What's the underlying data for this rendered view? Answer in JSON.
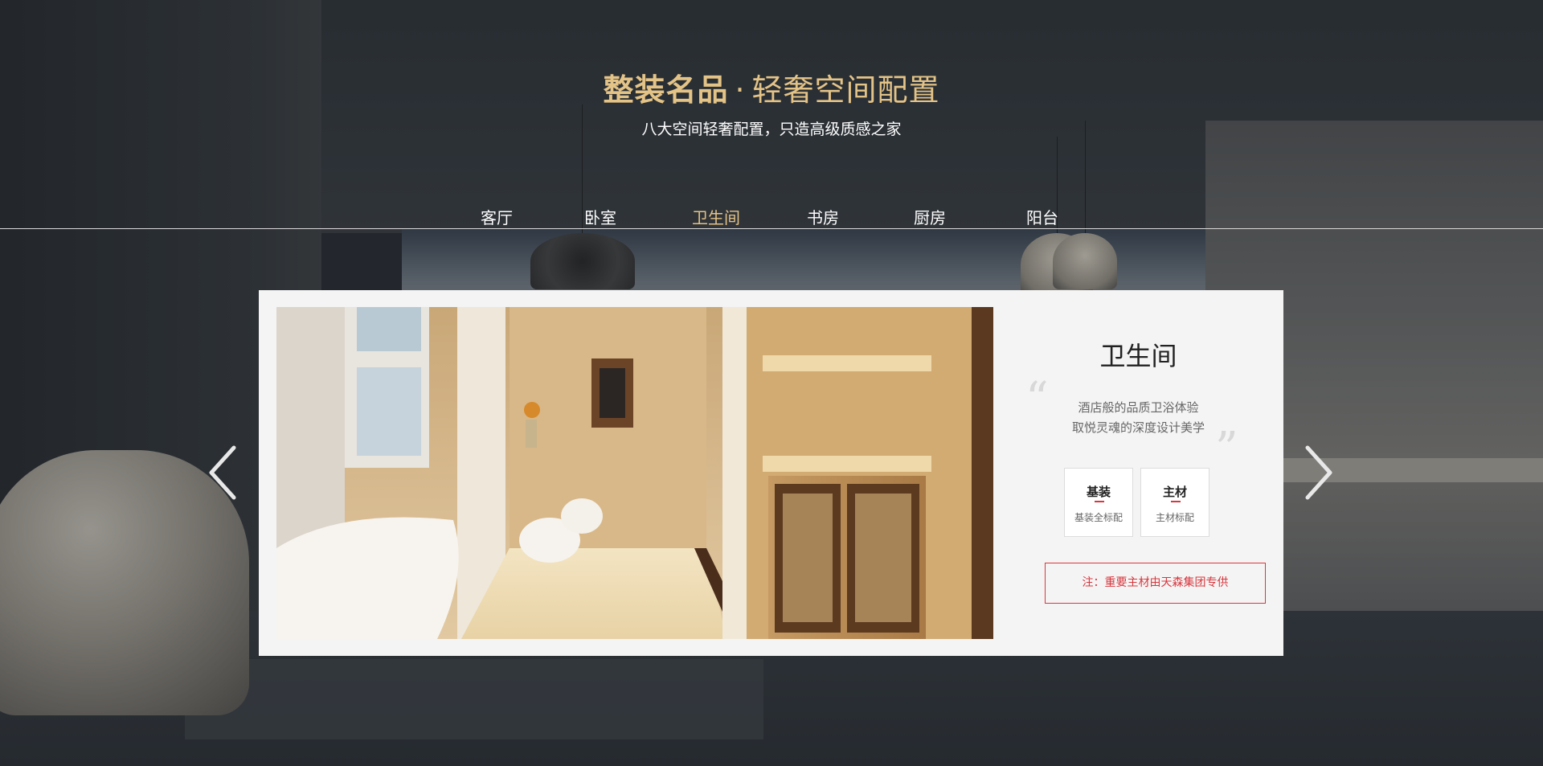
{
  "header": {
    "title_strong": "整装名品",
    "title_dot": "·",
    "title_light": "轻奢空间配置",
    "subtitle": "八大空间轻奢配置，只造高级质感之家"
  },
  "tabs": [
    {
      "label": "客厅"
    },
    {
      "label": "卧室"
    },
    {
      "label": "卫生间",
      "active": true
    },
    {
      "label": "书房"
    },
    {
      "label": "厨房"
    },
    {
      "label": "阳台"
    }
  ],
  "card": {
    "title": "卫生间",
    "quote_open": "“",
    "quote_close": "”",
    "desc_line1": "酒店般的品质卫浴体验",
    "desc_line2": "取悦灵魂的深度设计美学",
    "features": [
      {
        "title": "基装",
        "subtitle": "基装全标配"
      },
      {
        "title": "主材",
        "subtitle": "主材标配"
      }
    ],
    "note": "注：重要主材由天森集团专供"
  },
  "colors": {
    "gold": "#e4c387",
    "red": "#d7373e",
    "card_bg": "#f4f4f4"
  },
  "icons": {
    "prev": "chevron-left-icon",
    "next": "chevron-right-icon"
  }
}
